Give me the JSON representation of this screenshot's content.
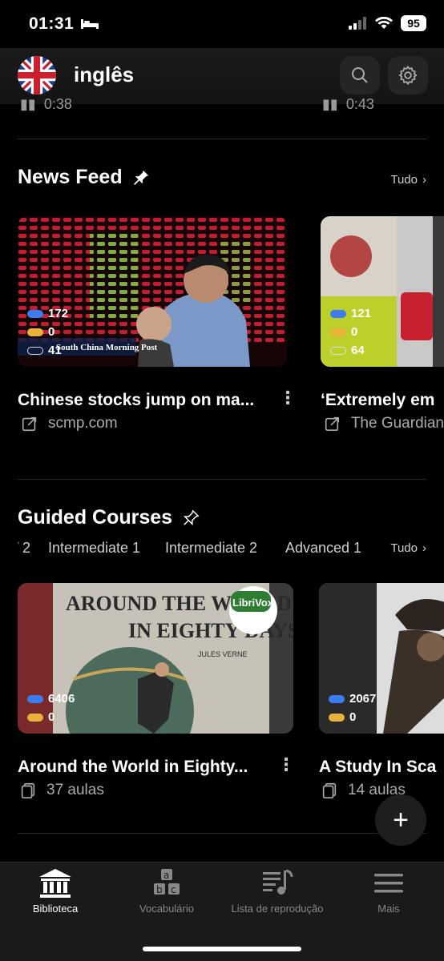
{
  "status": {
    "time": "01:31",
    "battery": "95"
  },
  "header": {
    "language": "inglês"
  },
  "partial": {
    "left_time": "0:38",
    "right_time": "0:43"
  },
  "news": {
    "title": "News Feed",
    "more": "Tudo",
    "cards": [
      {
        "stat_blue": "172",
        "stat_yellow": "0",
        "stat_outline": "41",
        "watermark": "South China Morning Post",
        "title": "Chinese stocks jump on ma...",
        "source": "scmp.com"
      },
      {
        "stat_blue": "121",
        "stat_yellow": "0",
        "stat_outline": "64",
        "title": "‘Extremely em",
        "source": "The Guardian"
      }
    ]
  },
  "courses": {
    "title": "Guided Courses",
    "more": "Tudo",
    "levels": [
      "2",
      "Intermediate 1",
      "Intermediate 2",
      "Advanced 1"
    ],
    "cards": [
      {
        "book_title_line1": "AROUND THE WORLD",
        "book_title_line2": "IN EIGHTY DAYS",
        "author": "JULES VERNE",
        "badge": "LibriVox",
        "stat_blue": "6406",
        "stat_yellow": "0",
        "title": "Around the World in Eighty...",
        "lessons": "37 aulas"
      },
      {
        "stat_blue": "2067",
        "stat_yellow": "0",
        "title": "A Study In Sca",
        "lessons": "14 aulas"
      }
    ]
  },
  "tabs": [
    {
      "label": "Biblioteca",
      "icon": "library-icon",
      "active": true
    },
    {
      "label": "Vocabulário",
      "icon": "abc-blocks-icon"
    },
    {
      "label": "Lista de reprodução",
      "icon": "playlist-icon"
    },
    {
      "label": "Mais",
      "icon": "menu-icon"
    }
  ],
  "colors": {
    "blue": "#3b7cf0",
    "yellow": "#e9b23a",
    "background": "#000000"
  }
}
